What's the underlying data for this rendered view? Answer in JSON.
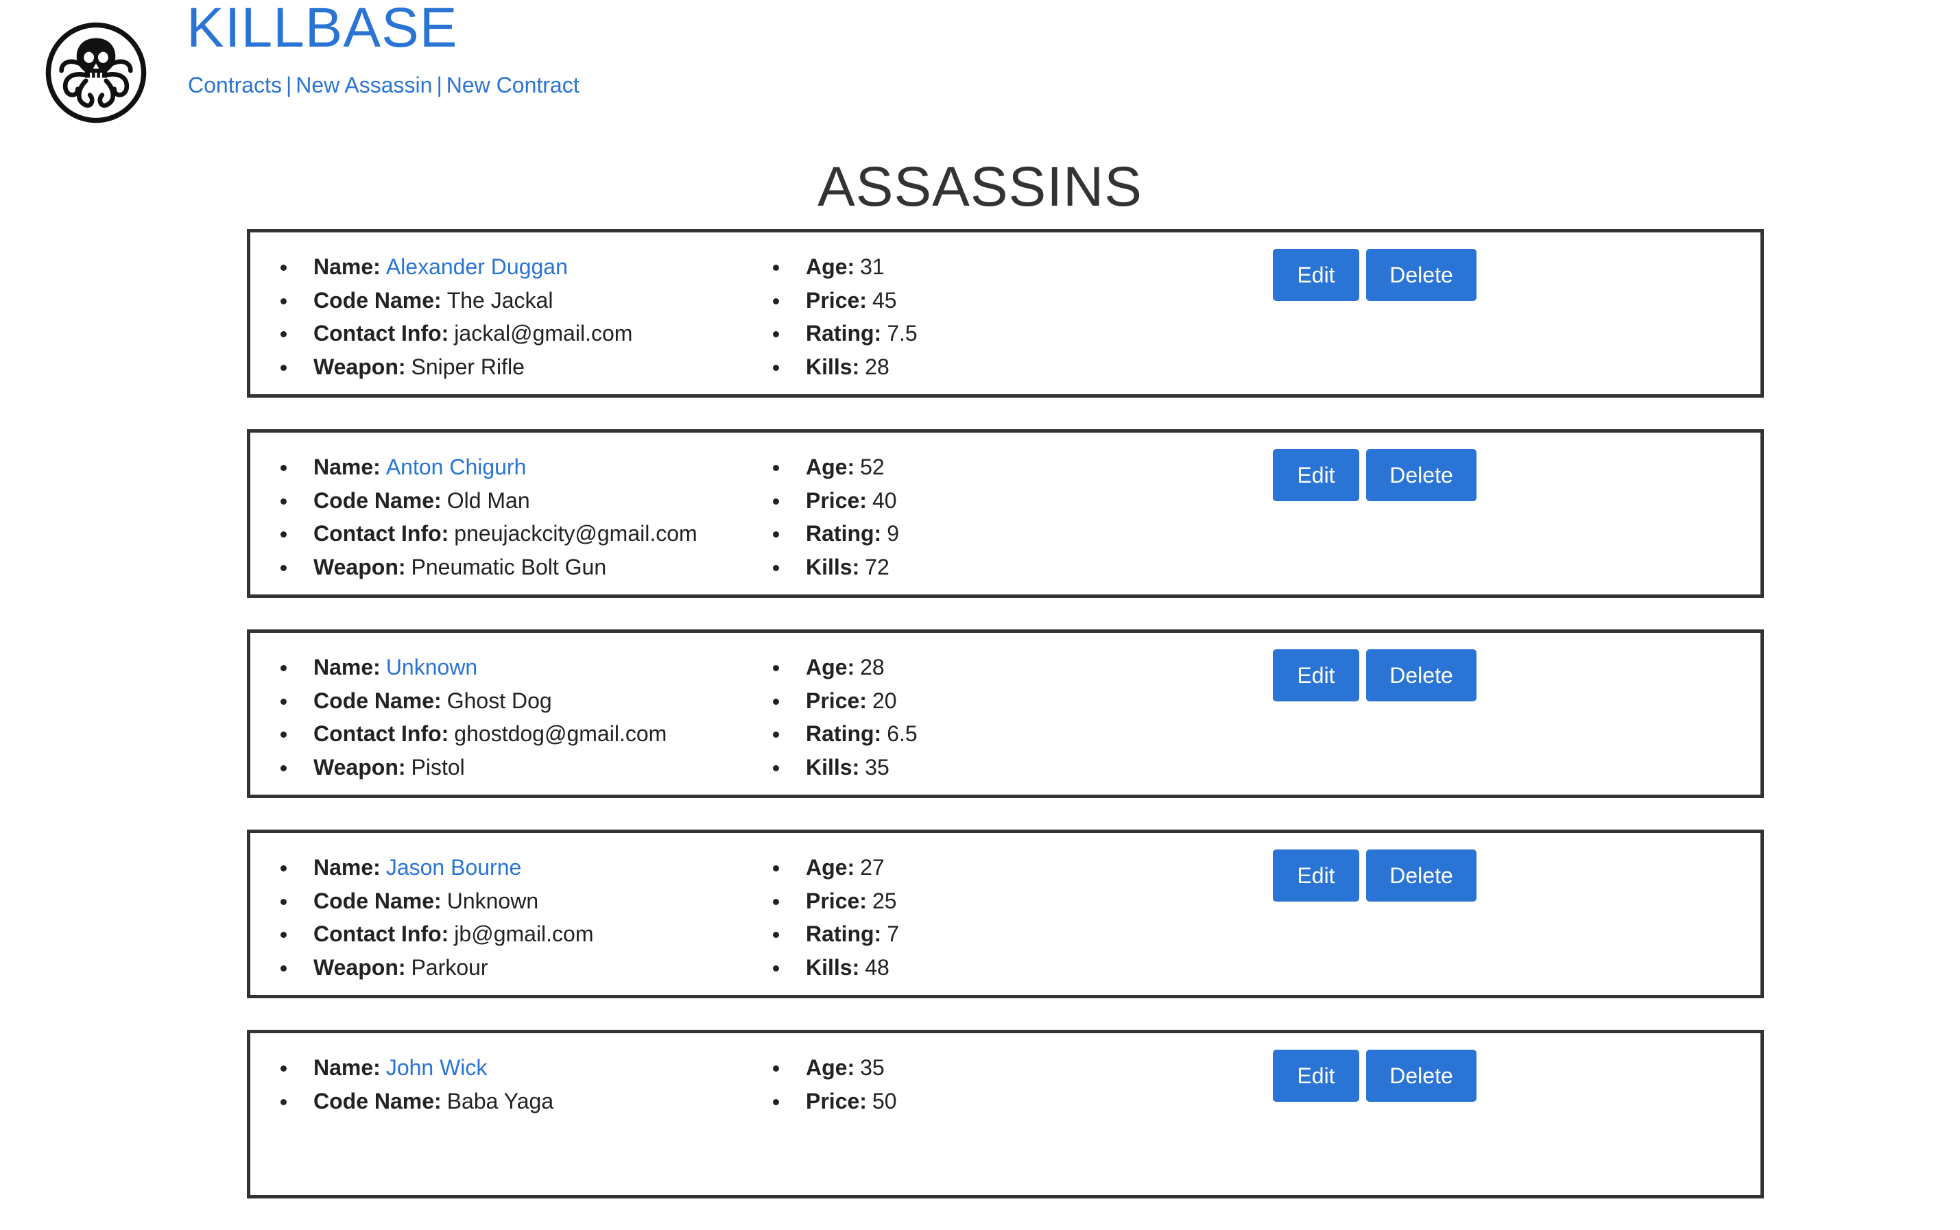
{
  "header": {
    "brand": "KILLBASE",
    "logo_icon": "octopus-skull-logo-icon",
    "nav": [
      {
        "label": "Contracts"
      },
      {
        "label": "New Assassin"
      },
      {
        "label": "New Contract"
      }
    ],
    "nav_separator": "|"
  },
  "page_title": "ASSASSINS",
  "field_labels": {
    "name": "Name:",
    "code_name": "Code Name:",
    "contact": "Contact Info:",
    "weapon": "Weapon:",
    "age": "Age:",
    "price": "Price:",
    "rating": "Rating:",
    "kills": "Kills:"
  },
  "buttons": {
    "edit": "Edit",
    "delete": "Delete"
  },
  "colors": {
    "accent": "#2a74d5",
    "border": "#333333",
    "text": "#222222"
  },
  "assassins": [
    {
      "name": "Alexander Duggan",
      "code_name": "The Jackal",
      "contact": "jackal@gmail.com",
      "weapon": "Sniper Rifle",
      "age": "31",
      "price": "45",
      "rating": "7.5",
      "kills": "28"
    },
    {
      "name": "Anton Chigurh",
      "code_name": "Old Man",
      "contact": "pneujackcity@gmail.com",
      "weapon": "Pneumatic Bolt Gun",
      "age": "52",
      "price": "40",
      "rating": "9",
      "kills": "72"
    },
    {
      "name": "Unknown",
      "code_name": "Ghost Dog",
      "contact": "ghostdog@gmail.com",
      "weapon": "Pistol",
      "age": "28",
      "price": "20",
      "rating": "6.5",
      "kills": "35"
    },
    {
      "name": "Jason Bourne",
      "code_name": "Unknown",
      "contact": "jb@gmail.com",
      "weapon": "Parkour",
      "age": "27",
      "price": "25",
      "rating": "7",
      "kills": "48"
    },
    {
      "name": "John Wick",
      "code_name": "Baba Yaga",
      "contact": "",
      "weapon": "",
      "age": "35",
      "price": "50",
      "rating": "",
      "kills": ""
    }
  ]
}
